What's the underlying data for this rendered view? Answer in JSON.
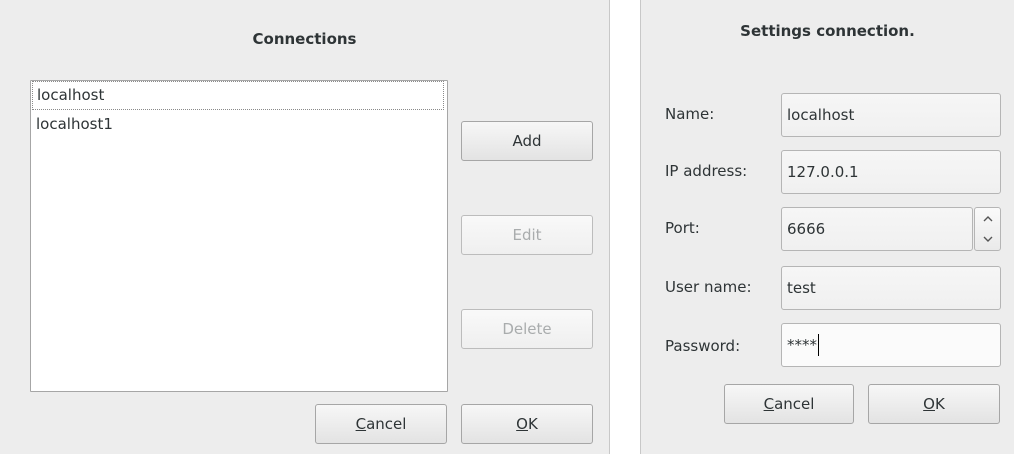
{
  "connections": {
    "title": "Connections",
    "items": [
      "localhost",
      "localhost1"
    ],
    "add_label": "Add",
    "edit_label": "Edit",
    "delete_label": "Delete",
    "cancel_mnemonic": "C",
    "cancel_rest": "ancel",
    "ok_mnemonic": "O",
    "ok_rest": "K"
  },
  "settings": {
    "title": "Settings connection.",
    "name_label": "Name:",
    "name_value": "localhost",
    "ip_label": "IP address:",
    "ip_value": "127.0.0.1",
    "port_label": "Port:",
    "port_value": "6666",
    "user_label": "User name:",
    "user_value": "test",
    "password_label": "Password:",
    "password_value": "****",
    "cancel_mnemonic": "C",
    "cancel_rest": "ancel",
    "ok_mnemonic": "O",
    "ok_rest": "K"
  },
  "icons": {
    "spin_up": "chevron-up-icon",
    "spin_down": "chevron-down-icon"
  }
}
